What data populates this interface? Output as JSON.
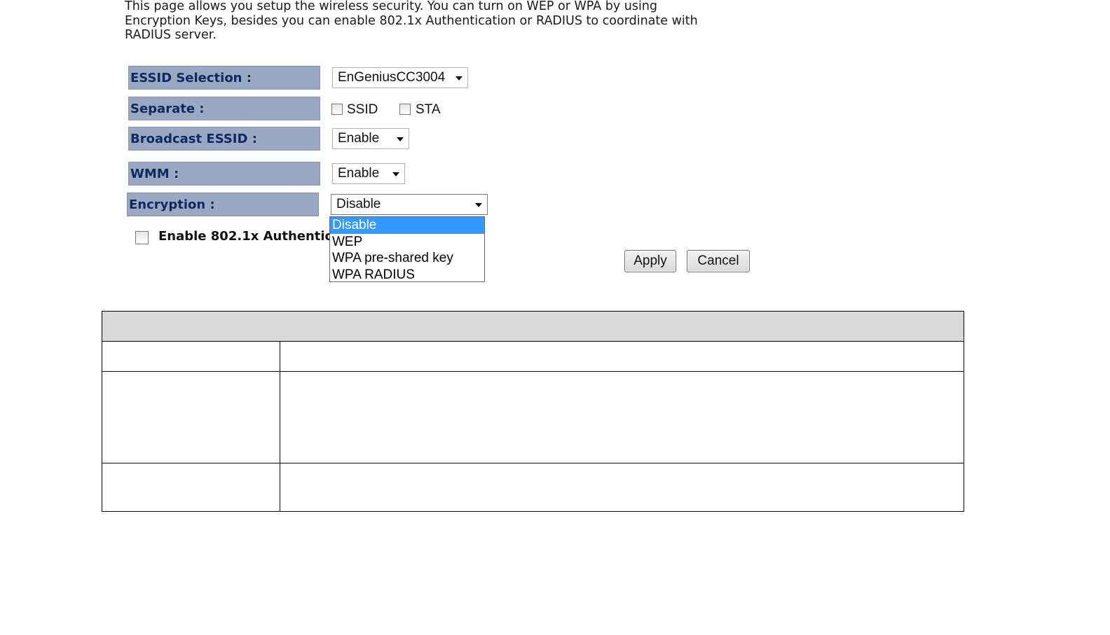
{
  "intro": {
    "line1": "This page allows you setup the wireless security. You can turn on WEP or WPA by using",
    "line2": "Encryption Keys, besides you can enable 802.1x Authentication or RADIUS to coordinate with",
    "line3": "RADIUS server."
  },
  "form": {
    "essid_label": "ESSID Selection :",
    "essid_value": "EnGeniusCC3004",
    "separate_label": "Separate :",
    "separate_ssid": "SSID",
    "separate_sta": "STA",
    "broadcast_label": "Broadcast ESSID :",
    "broadcast_value": "Enable",
    "wmm_label": "WMM :",
    "wmm_value": "Enable",
    "encryption_label": "Encryption :",
    "encryption_value": "Disable",
    "encryption_options": [
      "Disable",
      "WEP",
      "WPA pre-shared key",
      "WPA RADIUS"
    ],
    "enable_8021x_label": "Enable 802.1x Authentica"
  },
  "buttons": {
    "apply": "Apply",
    "cancel": "Cancel"
  },
  "colors": {
    "label_bg": "#9aa9c3",
    "label_text": "#0d2a5e",
    "highlight": "#3399ff",
    "table_header": "#d9d9d9"
  }
}
